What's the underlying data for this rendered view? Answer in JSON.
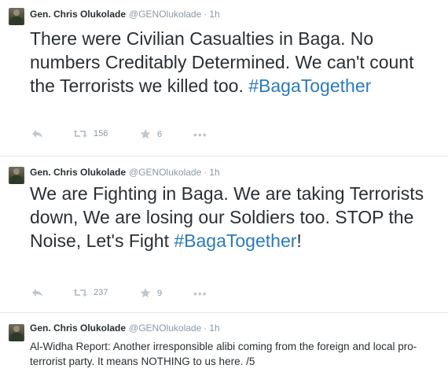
{
  "tweets": [
    {
      "fullname": "Gen. Chris Olukolade",
      "username": "@GENOlukolade",
      "dot": "·",
      "time": "1h",
      "text": "There were Civilian Casualties in Baga. No numbers Creditably Determined. We can't count the Terrorists we killed too.",
      "hashtag": "#BagaTogether",
      "suffix": "",
      "retweets": "156",
      "favorites": "6",
      "more": "•••"
    },
    {
      "fullname": "Gen. Chris Olukolade",
      "username": "@GENOlukolade",
      "dot": "·",
      "time": "1h",
      "text": "We are Fighting in Baga. We are taking Terrorists down, We are losing our Soldiers too. STOP the Noise, Let's Fight",
      "hashtag": "#BagaTogether",
      "suffix": "!",
      "retweets": "237",
      "favorites": "9",
      "more": "•••"
    },
    {
      "fullname": "Gen. Chris Olukolade",
      "username": "@GENOlukolade",
      "dot": "·",
      "time": "1h",
      "text": "Al-Widha Report: Another irresponsible alibi coming from the foreign and local pro-terrorist party. It means NOTHING to us here. /5"
    }
  ],
  "icons": {
    "reply": "reply-icon",
    "retweet": "retweet-icon",
    "favorite": "star-icon",
    "more": "more-icon"
  },
  "colors": {
    "hashtag": "#2b7bb9",
    "meta": "#8899a6",
    "divider": "#e1e8ed",
    "text": "#292f33"
  }
}
